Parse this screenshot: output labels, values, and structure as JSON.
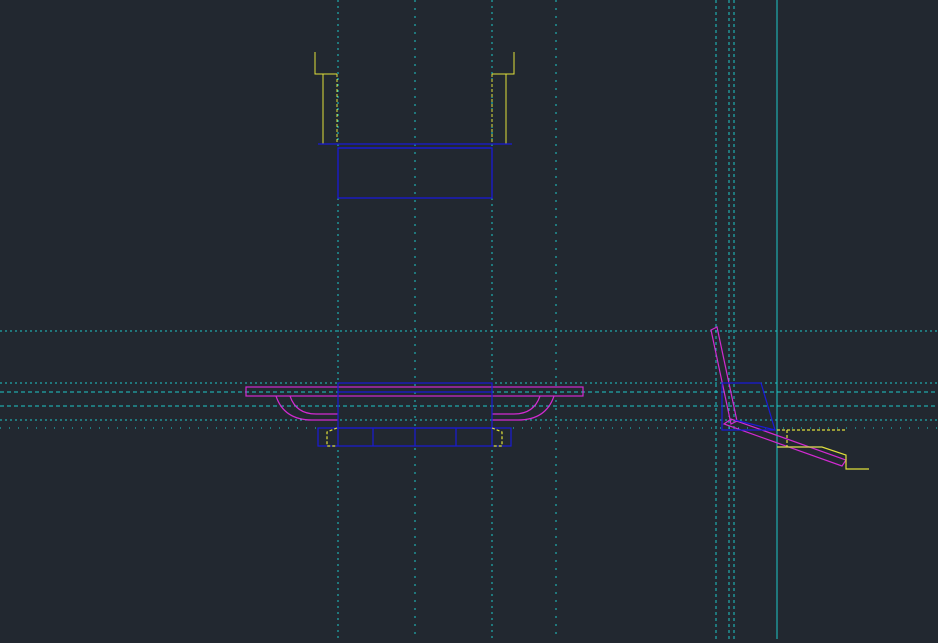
{
  "colors": {
    "background": "#222830",
    "guide": "#1fc9c9",
    "frame": "#1a1ad6",
    "outline": "#d12ad1",
    "detail": "#e0e03a"
  },
  "view": {
    "name": "cad-drawing-workspace"
  }
}
